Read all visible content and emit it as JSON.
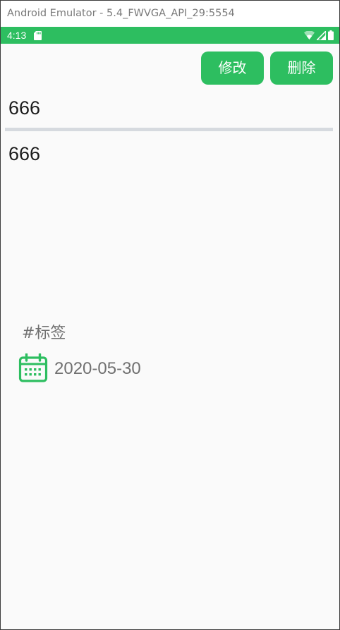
{
  "window": {
    "title": "Android Emulator - 5.4_FWVGA_API_29:5554"
  },
  "status_bar": {
    "time": "4:13",
    "icons": [
      "sd-card-icon",
      "wifi-icon",
      "signal-icon",
      "battery-icon"
    ],
    "color": "#2dbe60"
  },
  "toolbar": {
    "edit_label": "修改",
    "delete_label": "删除"
  },
  "note": {
    "title": "666",
    "body": "666",
    "tag": "#标签",
    "date": "2020-05-30"
  },
  "colors": {
    "accent": "#2dbe60",
    "background": "#fafafa",
    "divider": "#d6dadf",
    "meta_text": "#707070"
  }
}
